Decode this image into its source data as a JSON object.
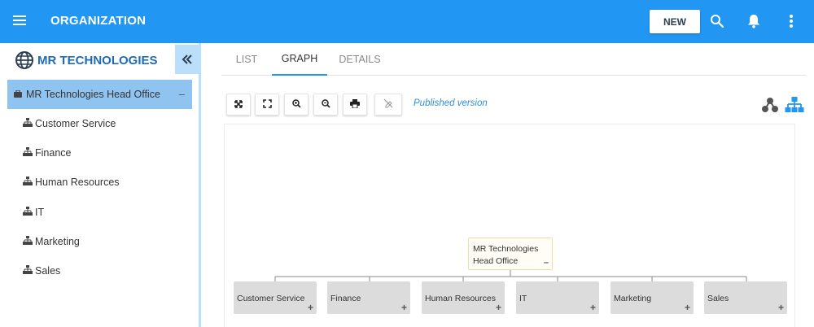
{
  "appbar": {
    "title": "ORGANIZATION",
    "new_label": "NEW",
    "icons": [
      "menu-icon",
      "search-icon",
      "bell-icon",
      "more-vertical-icon"
    ],
    "color": "#2196f3"
  },
  "sidebar": {
    "org_name": "MR TECHNOLOGIES",
    "org_icon": "globe-icon",
    "collapse_icon": "double-chevron-left-icon",
    "root": {
      "label": "MR Technologies Head Office",
      "icon": "briefcase-icon",
      "toggle": "–"
    },
    "children": [
      {
        "label": "Customer Service",
        "icon": "org-chart-icon"
      },
      {
        "label": "Finance",
        "icon": "org-chart-icon"
      },
      {
        "label": "Human Resources",
        "icon": "org-chart-icon"
      },
      {
        "label": "IT",
        "icon": "org-chart-icon"
      },
      {
        "label": "Marketing",
        "icon": "org-chart-icon"
      },
      {
        "label": "Sales",
        "icon": "org-chart-icon"
      }
    ]
  },
  "tabs": [
    {
      "label": "LIST",
      "active": false
    },
    {
      "label": "GRAPH",
      "active": true
    },
    {
      "label": "DETAILS",
      "active": false
    }
  ],
  "toolbar": {
    "buttons": [
      "expand-icon",
      "fullscreen-icon",
      "zoom-in-icon",
      "zoom-out-icon",
      "print-icon",
      "edit-off-icon"
    ],
    "status": "Published version",
    "view_icons": [
      "network-view-icon",
      "hierarchy-view-icon"
    ]
  },
  "graph": {
    "root": {
      "label": "MR Technologies Head Office",
      "toggle": "–"
    },
    "children": [
      {
        "label": "Customer Service",
        "toggle": "+"
      },
      {
        "label": "Finance",
        "toggle": "+"
      },
      {
        "label": "Human Resources",
        "toggle": "+"
      },
      {
        "label": "IT",
        "toggle": "+"
      },
      {
        "label": "Marketing",
        "toggle": "+"
      },
      {
        "label": "Sales",
        "toggle": "+"
      }
    ]
  }
}
